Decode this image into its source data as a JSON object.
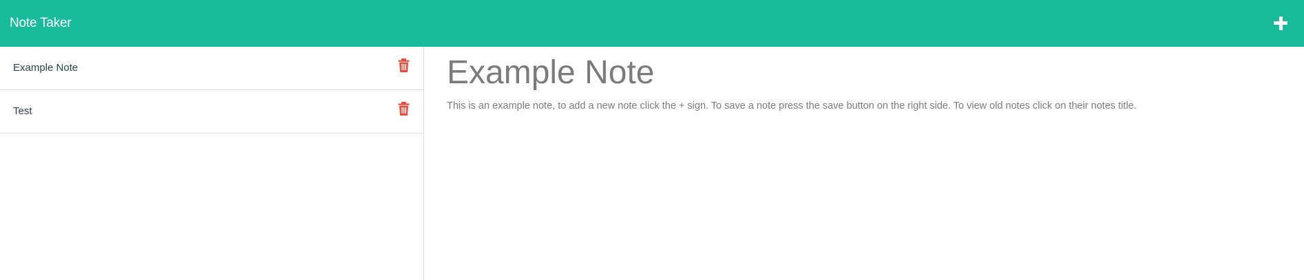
{
  "navbar": {
    "brand": "Note Taker",
    "add_icon": "plus-icon"
  },
  "sidebar": {
    "notes": [
      {
        "title": "Example Note",
        "icon": "trash-icon"
      },
      {
        "title": "Test",
        "icon": "trash-icon"
      }
    ]
  },
  "main": {
    "title": "Example Note",
    "body": "This is an example note, to add a new note click the + sign. To save a note press the save button on the right side. To view old notes click on their notes title."
  },
  "colors": {
    "accent": "#18bc9c",
    "delete": "#e74c3c",
    "text_muted": "#7b7b7b",
    "text_dark": "#2c3e50"
  }
}
